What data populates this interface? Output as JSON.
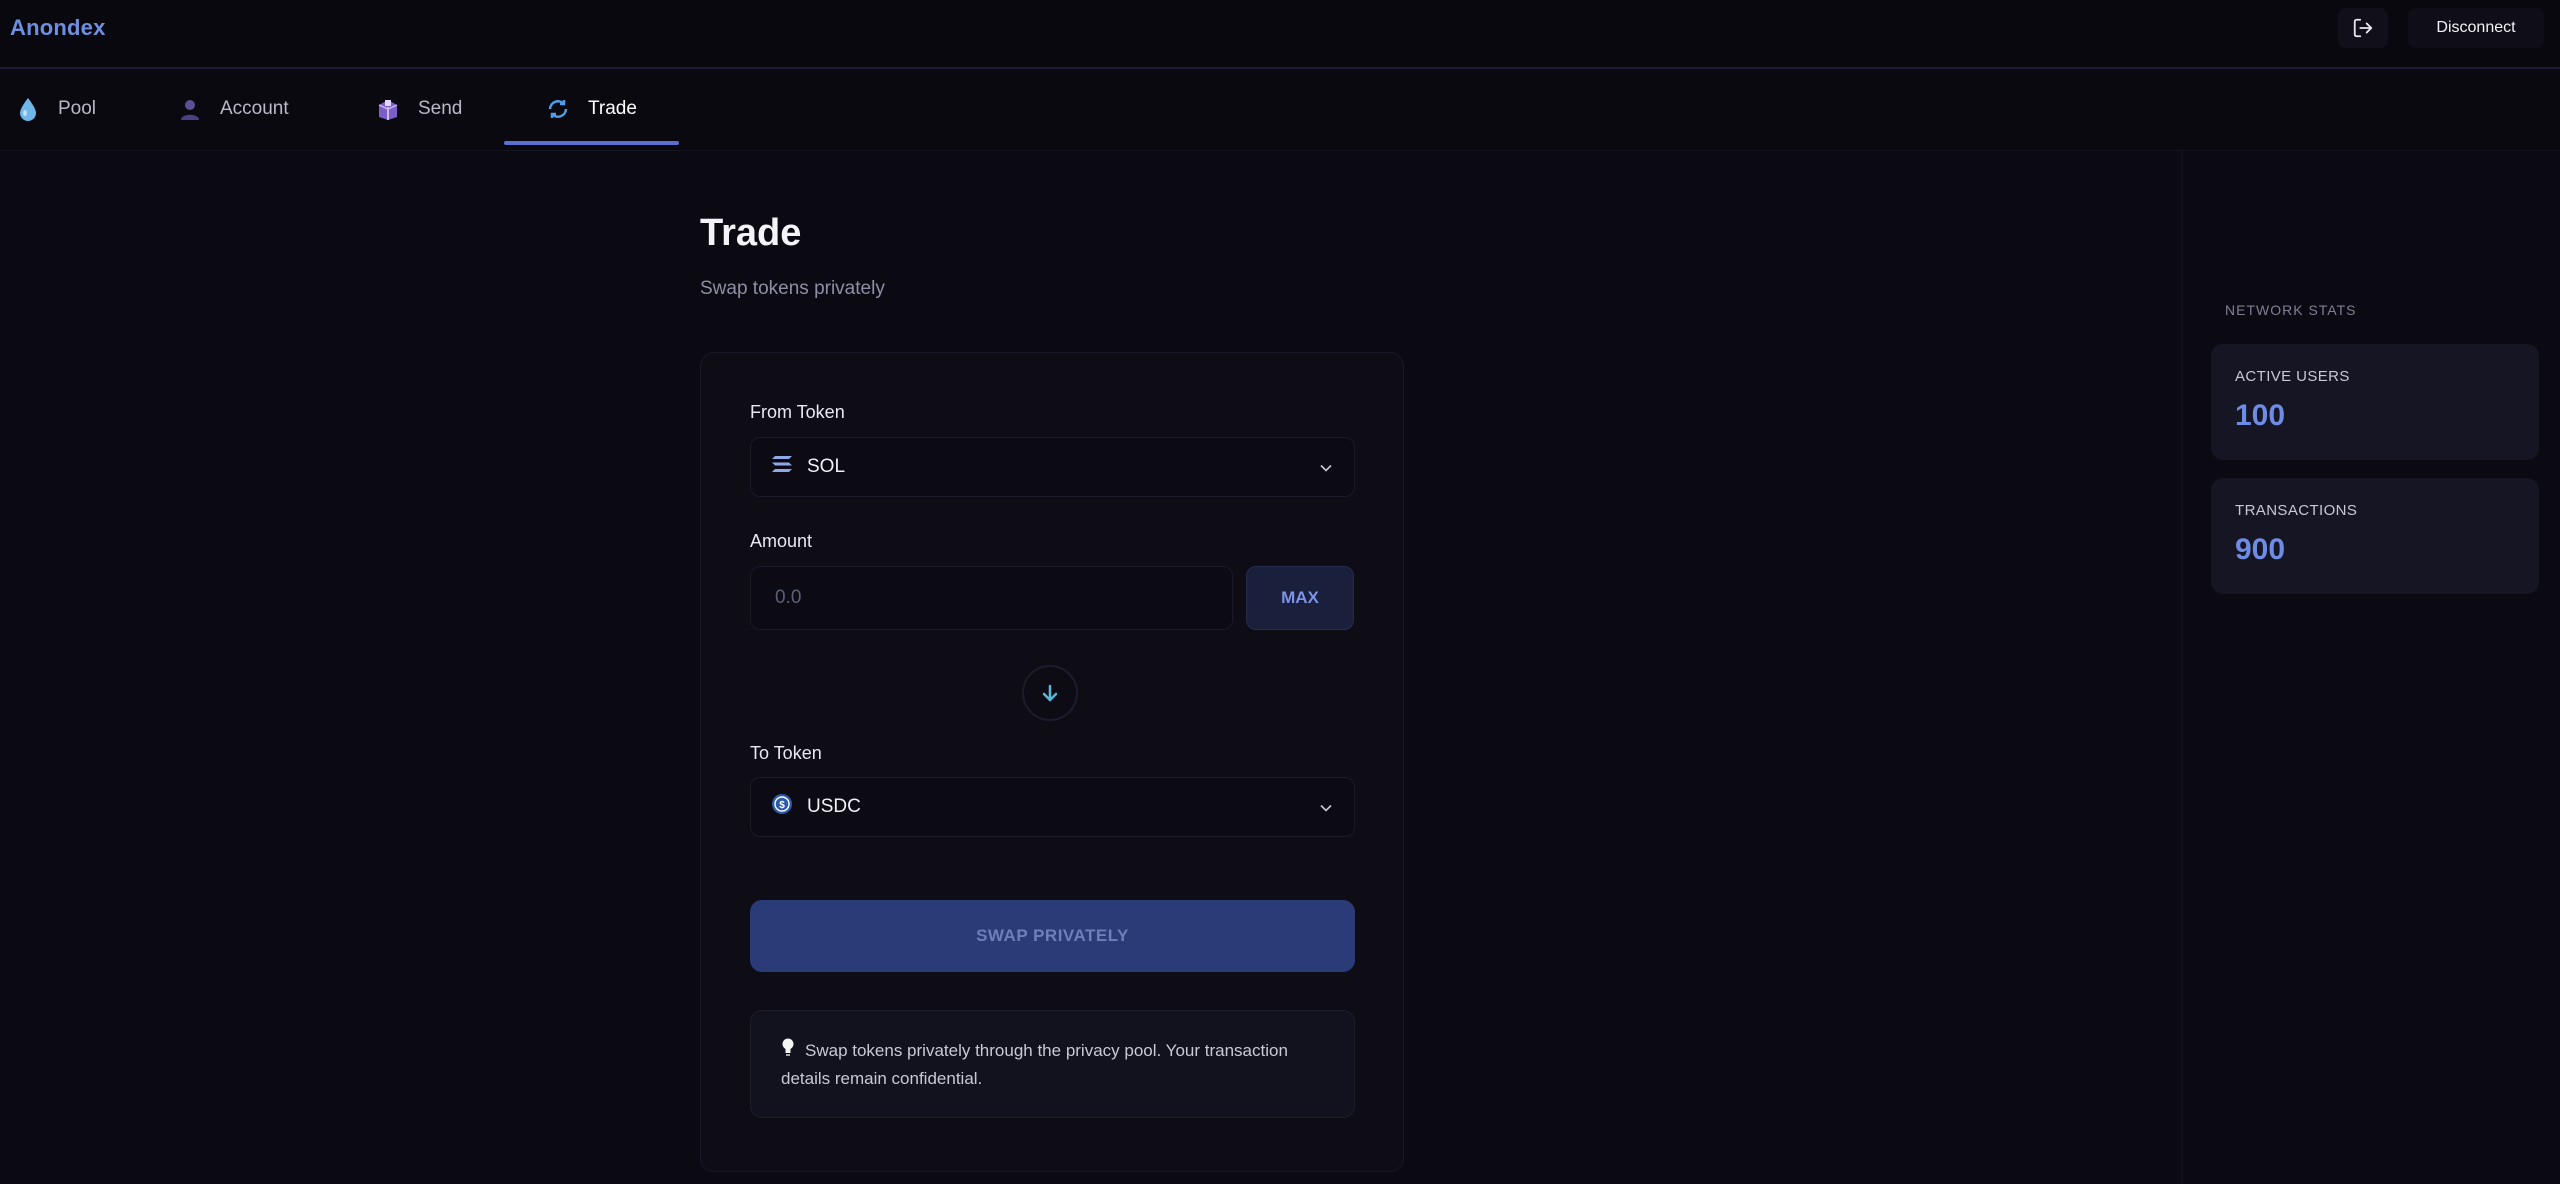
{
  "header": {
    "brand": "Anondex",
    "disconnect_label": "Disconnect",
    "logout_icon": "logout-icon"
  },
  "tabs": [
    {
      "label": "Pool",
      "icon": "droplet-icon",
      "active": false
    },
    {
      "label": "Account",
      "icon": "user-icon",
      "active": false
    },
    {
      "label": "Send",
      "icon": "package-icon",
      "active": false
    },
    {
      "label": "Trade",
      "icon": "swap-cycle-icon",
      "active": true
    }
  ],
  "main": {
    "title": "Trade",
    "subtitle": "Swap tokens privately",
    "from_label": "From Token",
    "from_token": "SOL",
    "amount_label": "Amount",
    "amount_placeholder": "0.0",
    "max_label": "MAX",
    "to_label": "To Token",
    "to_token": "USDC",
    "swap_button_label": "SWAP PRIVATELY",
    "info_text": "Swap tokens privately through the privacy pool. Your transaction details remain confidential."
  },
  "stats": {
    "heading": "NETWORK STATS",
    "items": [
      {
        "label": "ACTIVE USERS",
        "value": "100"
      },
      {
        "label": "TRANSACTIONS",
        "value": "900"
      }
    ]
  },
  "colors": {
    "accent": "#5a6fd0",
    "stat_value": "#6f8ce4",
    "swap_button": "#2a3b78",
    "background": "#0b0a12"
  }
}
